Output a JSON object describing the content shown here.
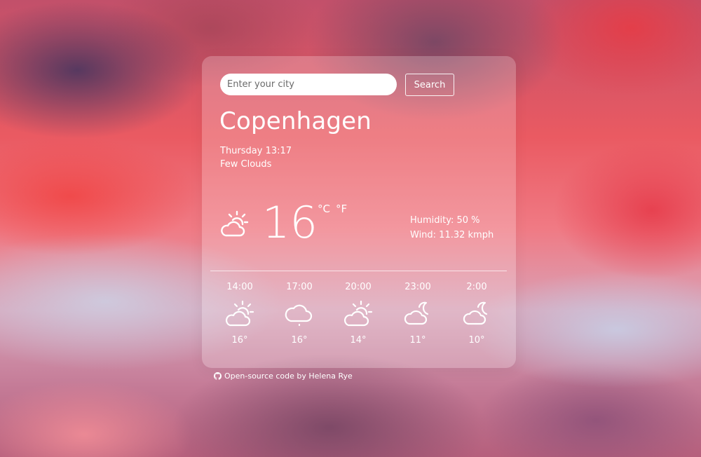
{
  "search": {
    "placeholder": "Enter your city",
    "value": "",
    "button_label": "Search"
  },
  "current": {
    "city": "Copenhagen",
    "date": "Thursday 13:17",
    "description": "Few Clouds",
    "icon": "few-clouds-icon",
    "temperature": "16",
    "unit_celsius": "°C",
    "unit_fahrenheit": "°F",
    "humidity": "Humidity: 50 %",
    "wind": "Wind: 11.32 kmph"
  },
  "forecast": [
    {
      "time": "14:00",
      "icon": "few-clouds-icon",
      "temp": "16°"
    },
    {
      "time": "17:00",
      "icon": "cloud-drizzle-icon",
      "temp": "16°"
    },
    {
      "time": "20:00",
      "icon": "few-clouds-icon",
      "temp": "14°"
    },
    {
      "time": "23:00",
      "icon": "night-clouds-icon",
      "temp": "11°"
    },
    {
      "time": "2:00",
      "icon": "night-clouds-icon",
      "temp": "10°"
    }
  ],
  "footer": {
    "icon": "github-icon",
    "text": "Open-source code by Helena Rye"
  }
}
